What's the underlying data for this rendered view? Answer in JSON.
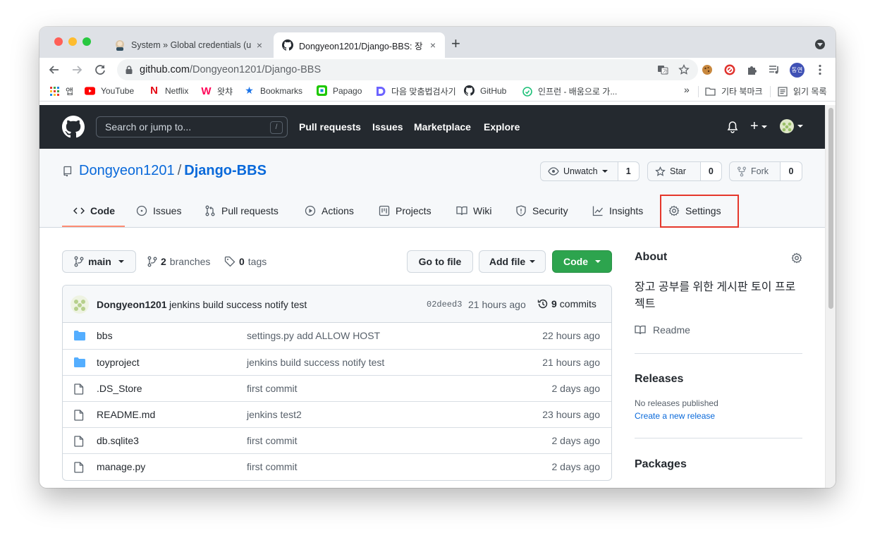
{
  "browser": {
    "tabs": [
      {
        "title": "System » Global credentials (u",
        "active": false
      },
      {
        "title": "Dongyeon1201/Django-BBS: 장",
        "active": true
      }
    ],
    "new_tab": "+",
    "close": "×",
    "url_host": "github.com",
    "url_path": "/Dongyeon1201/Django-BBS",
    "profile_label": "동연",
    "bookmarks": [
      {
        "label": "앱",
        "icon": "apps-grid-icon"
      },
      {
        "label": "YouTube",
        "icon": "youtube-icon"
      },
      {
        "label": "Netflix",
        "icon": "netflix-icon"
      },
      {
        "label": "왓챠",
        "icon": "watcha-icon"
      },
      {
        "label": "Bookmarks",
        "icon": "star-icon"
      },
      {
        "label": "Papago",
        "icon": "papago-icon"
      },
      {
        "label": "다음 맞춤법검사기",
        "icon": "daum-icon"
      },
      {
        "label": "GitHub",
        "icon": "github-icon"
      },
      {
        "label": "인프런 - 배움으로 가...",
        "icon": "inflearn-icon"
      }
    ],
    "bookmarks_more": "»",
    "other_bookmarks": "기타 북마크",
    "reading_list": "읽기 목록"
  },
  "github": {
    "search_placeholder": "Search or jump to...",
    "search_key": "/",
    "nav": [
      "Pull requests",
      "Issues",
      "Marketplace",
      "Explore"
    ],
    "repo": {
      "owner": "Dongyeon1201",
      "sep": "/",
      "name": "Django-BBS",
      "unwatch_label": "Unwatch",
      "unwatch_count": "1",
      "star_label": "Star",
      "star_count": "0",
      "fork_label": "Fork",
      "fork_count": "0"
    },
    "tabs": [
      "Code",
      "Issues",
      "Pull requests",
      "Actions",
      "Projects",
      "Wiki",
      "Security",
      "Insights",
      "Settings"
    ],
    "branch": "main",
    "branches_count": "2",
    "branches_label": "branches",
    "tags_count": "0",
    "tags_label": "tags",
    "go_to_file": "Go to file",
    "add_file": "Add file",
    "code_btn": "Code",
    "commit": {
      "author": "Dongyeon1201",
      "message": "jenkins build success notify test",
      "sha": "02deed3",
      "time": "21 hours ago",
      "commits_count": "9",
      "commits_label": "commits"
    },
    "files": [
      {
        "name": "bbs",
        "type": "dir",
        "message": "settings.py add ALLOW HOST",
        "age": "22 hours ago"
      },
      {
        "name": "toyproject",
        "type": "dir",
        "message": "jenkins build success notify test",
        "age": "21 hours ago"
      },
      {
        "name": ".DS_Store",
        "type": "file",
        "message": "first commit",
        "age": "2 days ago"
      },
      {
        "name": "README.md",
        "type": "file",
        "message": "jenkins test2",
        "age": "23 hours ago"
      },
      {
        "name": "db.sqlite3",
        "type": "file",
        "message": "first commit",
        "age": "2 days ago"
      },
      {
        "name": "manage.py",
        "type": "file",
        "message": "first commit",
        "age": "2 days ago"
      }
    ],
    "about": {
      "title": "About",
      "description": "장고 공부를 위한 게시판 토이 프로젝트",
      "readme": "Readme"
    },
    "releases": {
      "title": "Releases",
      "none": "No releases published",
      "create": "Create a new release"
    },
    "packages": {
      "title": "Packages"
    }
  },
  "colors": {
    "header_bg": "#24292f",
    "link": "#0969da",
    "green": "#2da44e",
    "highlight": "#e5372b",
    "folder": "#54aeff"
  }
}
